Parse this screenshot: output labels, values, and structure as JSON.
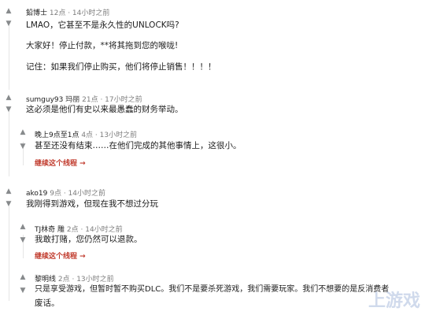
{
  "comments": [
    {
      "user": "鉛博士",
      "meta": "12点 · 14小时之前",
      "lines": [
        "LMAO，它甚至不是永久性的UNLOCK吗?",
        "大家好！停止付款，**将其拖到您的喉咙!",
        "记住：如果我们停止购买，他们将停止销售！！！！"
      ]
    },
    {
      "user": "sumguy93",
      "flair": "玛丽",
      "meta": "21点 · 17小时之前",
      "lines": [
        "这必须是他们有史以来最愚蠢的财务举动。"
      ]
    },
    {
      "user": "晚上9点至1点",
      "meta": "4点 · 13小时之前",
      "lines": [
        "甚至还没有结束……在他们完成的其他事情上，这很小。"
      ],
      "continue": "继续这个线程 →"
    },
    {
      "user": "ako19",
      "meta": "9点 · 14小时之前",
      "lines": [
        "我刚得到游戏，但现在我不想过分玩"
      ]
    },
    {
      "user": "TJ林奇",
      "flair": "雕",
      "meta": "2点 · 14小时之前",
      "lines": [
        "我敢打赌，您仍然可以退款。"
      ],
      "continue": "继续这个线程 →"
    },
    {
      "user": "黎明线",
      "meta": "2点 · 13小时之前",
      "lines": [
        "只是享受游戏，但暂时暂不购买DLC。我们不是要杀死游戏，我们需要玩家。我们不想要的是反消费者",
        "废话。"
      ]
    }
  ],
  "watermark": "上游戏"
}
